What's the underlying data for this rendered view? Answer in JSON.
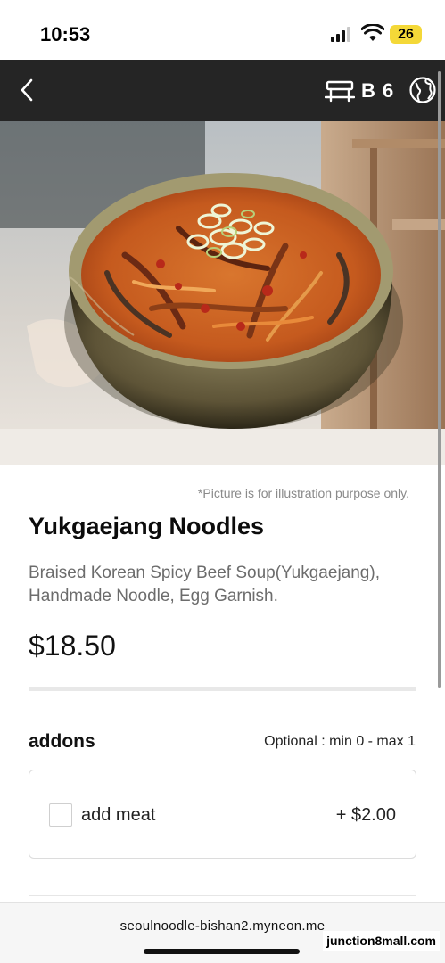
{
  "status_bar": {
    "time": "10:53",
    "battery_level": "26",
    "icons": [
      "signal-icon",
      "wifi-icon",
      "battery-icon"
    ],
    "battery_color": "#f4d838"
  },
  "header": {
    "background": "#252525",
    "back_icon": "chevron-left-icon",
    "table_icon": "table-icon",
    "table_number": "B 6",
    "language_icon": "globe-icon"
  },
  "hero": {
    "image_icon": "food-photo"
  },
  "item": {
    "disclaimer": "*Picture is for illustration purpose only.",
    "title": "Yukgaejang Noodles",
    "description": "Braised Korean Spicy Beef Soup(Yukgaejang), Handmade Noodle, Egg Garnish.",
    "price": "$18.50"
  },
  "addons": {
    "title": "addons",
    "rule": "Optional : min 0 - max 1",
    "options": [
      {
        "label": "add meat",
        "price": "+ $2.00",
        "checked": false
      }
    ]
  },
  "browser": {
    "url": "seoulnoodle-bishan2.myneon.me",
    "watermark": "junction8mall.com"
  }
}
